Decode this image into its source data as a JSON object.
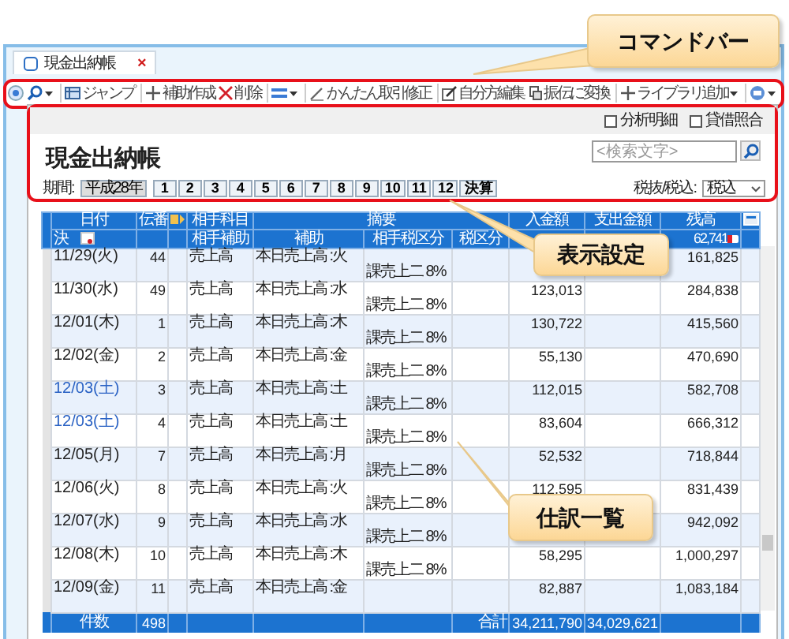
{
  "tab": {
    "label": "現金出納帳",
    "close": "×"
  },
  "toolbar": {
    "left": [
      [
        {
          "dropdown": false
        },
        {
          "dropdown": true
        }
      ],
      [
        {
          "label": "ジャンプ",
          "dropdown": false
        }
      ],
      [
        {
          "label": "補助作成",
          "dropdown": false
        },
        {
          "label": "削除",
          "dropdown": false
        }
      ],
      [
        {
          "dropdown": true
        }
      ]
    ],
    "right": [
      [
        {
          "label": "かんたん取引修正",
          "dropdown": false
        }
      ],
      [
        {
          "label": "自分方編集",
          "dropdown": false
        },
        {
          "label": "振伝に変換",
          "dropdown": false
        }
      ],
      [
        {
          "label": "ライブラリ追加",
          "dropdown": true
        }
      ],
      [
        {
          "dropdown": true
        }
      ]
    ]
  },
  "options": [
    {
      "label": "分析明細",
      "checked": false
    },
    {
      "label": "貸借照合",
      "checked": false
    }
  ],
  "title": "現金出納帳",
  "search": {
    "placeholder": "<検索文字>"
  },
  "period": {
    "label": "期間:",
    "year": "平成28年",
    "months": [
      "1",
      "2",
      "3",
      "4",
      "5",
      "6",
      "7",
      "8",
      "9",
      "10",
      "11",
      "12",
      "決算"
    ]
  },
  "tax_mode": {
    "label": "税抜/税込:",
    "value": "税込"
  },
  "table": {
    "header1": [
      "日付",
      "伝番",
      "相手科目",
      "摘要",
      "入金額",
      "支出金額",
      "残高"
    ],
    "header2": [
      "決",
      "相手補助",
      "補助",
      "相手税区分",
      "税区分"
    ],
    "carryover": "62,741",
    "rows": [
      {
        "date": "11/29(火)",
        "holiday": false,
        "number": "44",
        "account": "売上高",
        "summary": "本日売上高 :火",
        "deposit": "",
        "balance": "161,825",
        "tax": "課売上二 8%"
      },
      {
        "date": "11/30(水)",
        "holiday": false,
        "number": "49",
        "account": "売上高",
        "summary": "本日売上高 :水",
        "deposit": "123,013",
        "balance": "284,838",
        "tax": "課売上二 8%"
      },
      {
        "date": "12/01(木)",
        "holiday": false,
        "number": "1",
        "account": "売上高",
        "summary": "本日売上高 :木",
        "deposit": "130,722",
        "balance": "415,560",
        "tax": "課売上二 8%"
      },
      {
        "date": "12/02(金)",
        "holiday": false,
        "number": "2",
        "account": "売上高",
        "summary": "本日売上高 :金",
        "deposit": "55,130",
        "balance": "470,690",
        "tax": "課売上二 8%"
      },
      {
        "date": "12/03(土)",
        "holiday": true,
        "number": "3",
        "account": "売上高",
        "summary": "本日売上高 :土",
        "deposit": "112,015",
        "balance": "582,708",
        "tax": "課売上二 8%"
      },
      {
        "date": "12/03(土)",
        "holiday": true,
        "number": "4",
        "account": "売上高",
        "summary": "本日売上高 :土",
        "deposit": "83,604",
        "balance": "666,312",
        "tax": "課売上二 8%"
      },
      {
        "date": "12/05(月)",
        "holiday": false,
        "number": "7",
        "account": "売上高",
        "summary": "本日売上高 :月",
        "deposit": "52,532",
        "balance": "718,844",
        "tax": "課売上二 8%"
      },
      {
        "date": "12/06(火)",
        "holiday": false,
        "number": "8",
        "account": "売上高",
        "summary": "本日売上高 :火",
        "deposit": "112,595",
        "balance": "831,439",
        "tax": "課売上二 8%"
      },
      {
        "date": "12/07(水)",
        "holiday": false,
        "number": "9",
        "account": "売上高",
        "summary": "本日売上高 :水",
        "deposit": "",
        "balance": "942,092",
        "tax": "課売上二 8%"
      },
      {
        "date": "12/08(木)",
        "holiday": false,
        "number": "10",
        "account": "売上高",
        "summary": "本日売上高 :木",
        "deposit": "58,295",
        "balance": "1,000,297",
        "tax": "課売上二 8%"
      },
      {
        "date": "12/09(金)",
        "holiday": false,
        "number": "11",
        "account": "売上高",
        "summary": "本日売上高 :金",
        "deposit": "82,887",
        "balance": "1,083,184",
        "tax": ""
      }
    ],
    "footer": {
      "count_label": "件数",
      "count": "498",
      "total_label": "合計",
      "deposit_total": "34,211,790",
      "payment_total": "34,029,621"
    }
  },
  "callouts": [
    "コマンドバー",
    "表示設定",
    "仕訳一覧"
  ]
}
